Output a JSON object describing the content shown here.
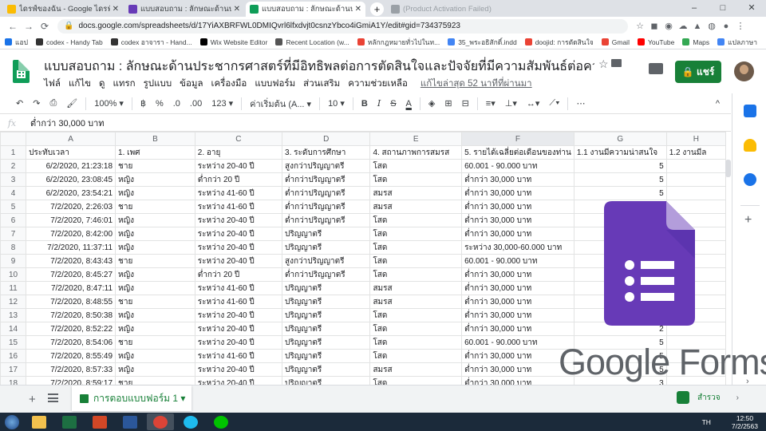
{
  "browser": {
    "tabs": [
      {
        "title": "ไดรฟ์ของฉัน - Google ไดรฟ์",
        "color": "#fbbc04"
      },
      {
        "title": "แบบสอบถาม : ลักษณะด้านประชากรศาสตร์ที่มีอิทธิพล",
        "color": "#673ab7"
      },
      {
        "title": "แบบสอบถาม : ลักษณะด้านประชากรศาสตร์ที่มีอิทธิพล",
        "color": "#0f9d58"
      },
      {
        "title": "(Product Activation Failed)",
        "color": "#9aa0a6"
      }
    ],
    "new_tab": "+",
    "window_controls": [
      "–",
      "□",
      "✕"
    ],
    "url": "docs.google.com/spreadsheets/d/17YiAXBRFWL0DMIQvrl6lfxdvjt0csnzYbco4iGmiA1Y/edit#gid=734375923",
    "nav": [
      "←",
      "→",
      "⟳"
    ],
    "bookmarks": [
      {
        "label": "แอป",
        "color": "#1a73e8"
      },
      {
        "label": "codex - Handy Tab",
        "color": "#333333"
      },
      {
        "label": "codex อาจารา - Hand...",
        "color": "#333333"
      },
      {
        "label": "Wix Website Editor",
        "color": "#000000"
      },
      {
        "label": "Recent Location (w...",
        "color": "#555555"
      },
      {
        "label": "หลักกฎหมายทั่วไปในท...",
        "color": "#ea4335"
      },
      {
        "label": "35_พระอธิสักดิ์.indd",
        "color": "#4285f4"
      },
      {
        "label": "doojid: การตัดสินใจ",
        "color": "#ea4335"
      },
      {
        "label": "Gmail",
        "color": "#ea4335"
      },
      {
        "label": "YouTube",
        "color": "#ff0000"
      },
      {
        "label": "Maps",
        "color": "#34a853"
      },
      {
        "label": "แปลภาษา",
        "color": "#4285f4"
      }
    ]
  },
  "doc": {
    "title": "แบบสอบถาม : ลักษณะด้านประชากรศาสตร์ที่มีอิทธิพลต่อการตัดสินใจและปัจจัยที่มีความสัมพันธ์ต่อความสนใจสมัคร...",
    "menus": [
      "ไฟล์",
      "แก้ไข",
      "ดู",
      "แทรก",
      "รูปแบบ",
      "ข้อมูล",
      "เครื่องมือ",
      "แบบฟอร์ม",
      "ส่วนเสริม",
      "ความช่วยเหลือ"
    ],
    "last_edit": "แก้ไขล่าสุด 52 นาทีที่ผ่านมา",
    "share_label": "🔒 แชร์"
  },
  "toolbar": {
    "zoom": "100% ▾",
    "percent": "%",
    "dec0": ".0",
    "dec00": ".00",
    "numfmt": "123 ▾",
    "font": "ค่าเริ่มต้น (A... ▾",
    "size": "10 ▾",
    "bold": "B",
    "italic": "I",
    "strike": "S",
    "textcolor": "A",
    "more": "⋯",
    "collapse": "^"
  },
  "formula_bar": {
    "label": "fx",
    "value": "ต่ำกว่า 30,000 บาท"
  },
  "sheet": {
    "columns": [
      "A",
      "B",
      "C",
      "D",
      "E",
      "F",
      "G",
      "H"
    ],
    "header_row": [
      "ประทับเวลา",
      "1. เพศ",
      "2. อายุ",
      "3. ระดับการศึกษา",
      "4. สถานภาพการสมรส",
      "5. รายได้เฉลี่ยต่อเดือนของท่าน",
      "1.1 งานมีความน่าสนใจ",
      "1.2 งานมีล"
    ],
    "rows": [
      [
        "6/2/2020, 21:23:18",
        "ชาย",
        "ระหว่าง 20-40 ปี",
        "สูงกว่าปริญญาตรี",
        "โสด",
        "60.001 - 90.000 บาท",
        "5"
      ],
      [
        "6/2/2020, 23:08:45",
        "หญิง",
        "ต่ำกว่า 20 ปี",
        "ต่ำกว่าปริญญาตรี",
        "โสด",
        "ต่ำกว่า 30,000 บาท",
        "5"
      ],
      [
        "6/2/2020, 23:54:21",
        "หญิง",
        "ระหว่าง 41-60 ปี",
        "ต่ำกว่าปริญญาตรี",
        "สมรส",
        "ต่ำกว่า 30,000 บาท",
        "5"
      ],
      [
        "7/2/2020, 2:26:03",
        "ชาย",
        "ระหว่าง 41-60 ปี",
        "ต่ำกว่าปริญญาตรี",
        "สมรส",
        "ต่ำกว่า 30,000 บาท",
        "2"
      ],
      [
        "7/2/2020, 7:46:01",
        "หญิง",
        "ระหว่าง 20-40 ปี",
        "ต่ำกว่าปริญญาตรี",
        "โสด",
        "ต่ำกว่า 30,000 บาท",
        "3"
      ],
      [
        "7/2/2020, 8:42:00",
        "หญิง",
        "ระหว่าง 20-40 ปี",
        "ปริญญาตรี",
        "โสด",
        "ต่ำกว่า 30,000 บาท",
        ""
      ],
      [
        "7/2/2020, 11:37:11",
        "หญิง",
        "ระหว่าง 20-40 ปี",
        "ปริญญาตรี",
        "โสด",
        "ระหว่าง 30,000-60.000 บาท",
        ""
      ],
      [
        "7/2/2020, 8:43:43",
        "ชาย",
        "ระหว่าง 20-40 ปี",
        "สูงกว่าปริญญาตรี",
        "โสด",
        "60.001 - 90.000 บาท",
        ""
      ],
      [
        "7/2/2020, 8:45:27",
        "หญิง",
        "ต่ำกว่า 20 ปี",
        "ต่ำกว่าปริญญาตรี",
        "โสด",
        "ต่ำกว่า 30,000 บาท",
        ""
      ],
      [
        "7/2/2020, 8:47:11",
        "หญิง",
        "ระหว่าง 41-60 ปี",
        "ปริญญาตรี",
        "สมรส",
        "ต่ำกว่า 30,000 บาท",
        ""
      ],
      [
        "7/2/2020, 8:48:55",
        "ชาย",
        "ระหว่าง 41-60 ปี",
        "ปริญญาตรี",
        "สมรส",
        "ต่ำกว่า 30,000 บาท",
        ""
      ],
      [
        "7/2/2020, 8:50:38",
        "หญิง",
        "ระหว่าง 20-40 ปี",
        "ปริญญาตรี",
        "โสด",
        "ต่ำกว่า 30,000 บาท",
        ""
      ],
      [
        "7/2/2020, 8:52:22",
        "หญิง",
        "ระหว่าง 20-40 ปี",
        "ปริญญาตรี",
        "โสด",
        "ต่ำกว่า 30,000 บาท",
        "2"
      ],
      [
        "7/2/2020, 8:54:06",
        "ชาย",
        "ระหว่าง 20-40 ปี",
        "ปริญญาตรี",
        "โสด",
        "60.001 - 90.000 บาท",
        "5"
      ],
      [
        "7/2/2020, 8:55:49",
        "หญิง",
        "ระหว่าง 41-60 ปี",
        "ปริญญาตรี",
        "โสด",
        "ต่ำกว่า 30,000 บาท",
        "5"
      ],
      [
        "7/2/2020, 8:57:33",
        "หญิง",
        "ระหว่าง 20-40 ปี",
        "ปริญญาตรี",
        "สมรส",
        "ต่ำกว่า 30,000 บาท",
        "5"
      ],
      [
        "7/2/2020, 8:59:17",
        "ชาย",
        "ระหว่าง 20-40 ปี",
        "ปริญญาตรี",
        "โสด",
        "ต่ำกว่า 30,000 บาท",
        "3"
      ]
    ],
    "active_sheet": "การตอบแบบฟอร์ม 1 ▾",
    "explore_label": "สำรวจ"
  },
  "overlay": {
    "brand_text": "Google Forms"
  },
  "taskbar": {
    "apps": [
      {
        "name": "explorer",
        "color": "#f2c14e"
      },
      {
        "name": "excel",
        "color": "#1d6f42"
      },
      {
        "name": "powerpoint",
        "color": "#d24726"
      },
      {
        "name": "word",
        "color": "#2b579a"
      },
      {
        "name": "chrome",
        "color": "#db4437"
      },
      {
        "name": "ie",
        "color": "#1ebbee"
      },
      {
        "name": "line",
        "color": "#00c300"
      }
    ],
    "lang": "TH",
    "time": "12:50",
    "date": "7/2/2563"
  }
}
